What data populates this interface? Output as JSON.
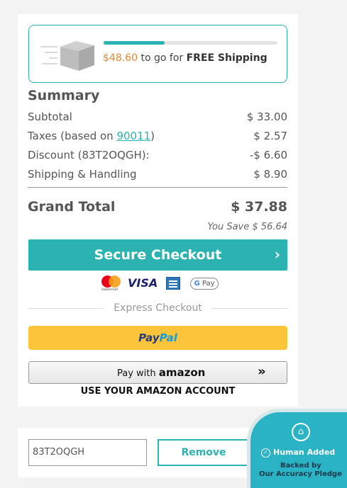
{
  "shipping": {
    "amount": "$48.60",
    "text": " to go for ",
    "free_label": "FREE Shipping",
    "progress_fraction": 0.35,
    "icon": "box-icon"
  },
  "summary": {
    "title": "Summary",
    "subtotal_label": "Subtotal",
    "subtotal_value": "$ 33.00",
    "taxes_prefix": "Taxes (based on ",
    "taxes_zip": "90011",
    "taxes_suffix": ")",
    "taxes_value": "$ 2.57",
    "discount_label": "Discount (83T2OQGH):",
    "discount_value": "-$ 6.60",
    "shipping_label": "Shipping & Handling",
    "shipping_value": "$ 8.90",
    "grand_label": "Grand Total",
    "grand_value": "$ 37.88",
    "you_save": "You Save $ 56.64"
  },
  "checkout": {
    "label": "Secure Checkout",
    "chevron": "›"
  },
  "payments": {
    "mastercard_text": "mastercard",
    "visa": "VISA",
    "gpay_g": "G",
    "gpay_text": " Pay",
    "icons": [
      "mastercard-icon",
      "visa-icon",
      "amex-icon",
      "google-pay-icon"
    ]
  },
  "express": {
    "label": "Express Checkout"
  },
  "paypal": {
    "pay": "Pay",
    "pal": "Pal"
  },
  "amazon": {
    "prefix": "Pay with ",
    "brand": "amazon",
    "arrow": "»",
    "sub": "USE YOUR AMAZON ACCOUNT"
  },
  "promo": {
    "code": "83T2OQGH",
    "remove_label": "Remove"
  },
  "badge": {
    "line1": "Human Added",
    "line2": "Backed by",
    "line3": "Our Accuracy Pledge",
    "icon": "home-icon"
  },
  "colors": {
    "accent": "#2ab3b0",
    "orange": "#e8872b",
    "paypal_yellow": "#fcc43a",
    "badge": "#2ab3c4"
  }
}
